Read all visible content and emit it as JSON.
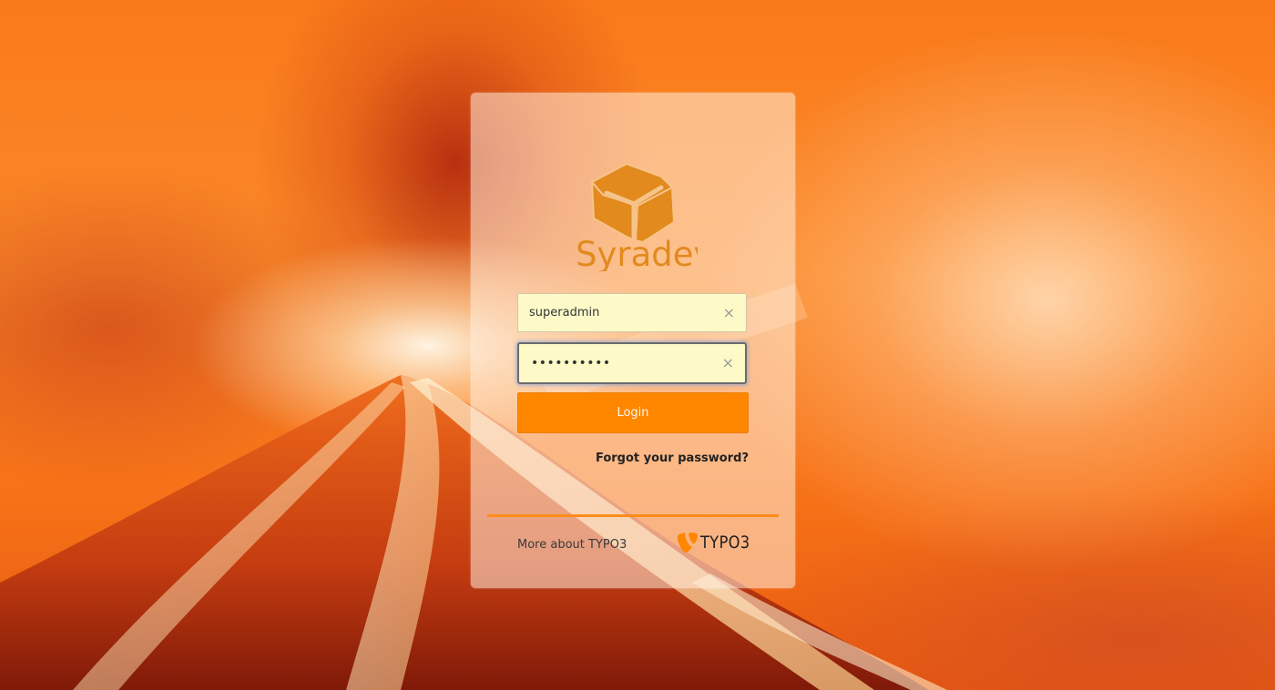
{
  "brand": {
    "name": "Syradev",
    "accent_color": "#ff8700",
    "logo_icon": "cube-icon"
  },
  "login_form": {
    "username_value": "superadmin",
    "password_value": "••••••••••",
    "clear_icon": "×",
    "login_label": "Login",
    "forgot_label": "Forgot your password?"
  },
  "footer": {
    "more_label": "More about TYPO3",
    "typo3_wordmark": "TYPO3"
  }
}
